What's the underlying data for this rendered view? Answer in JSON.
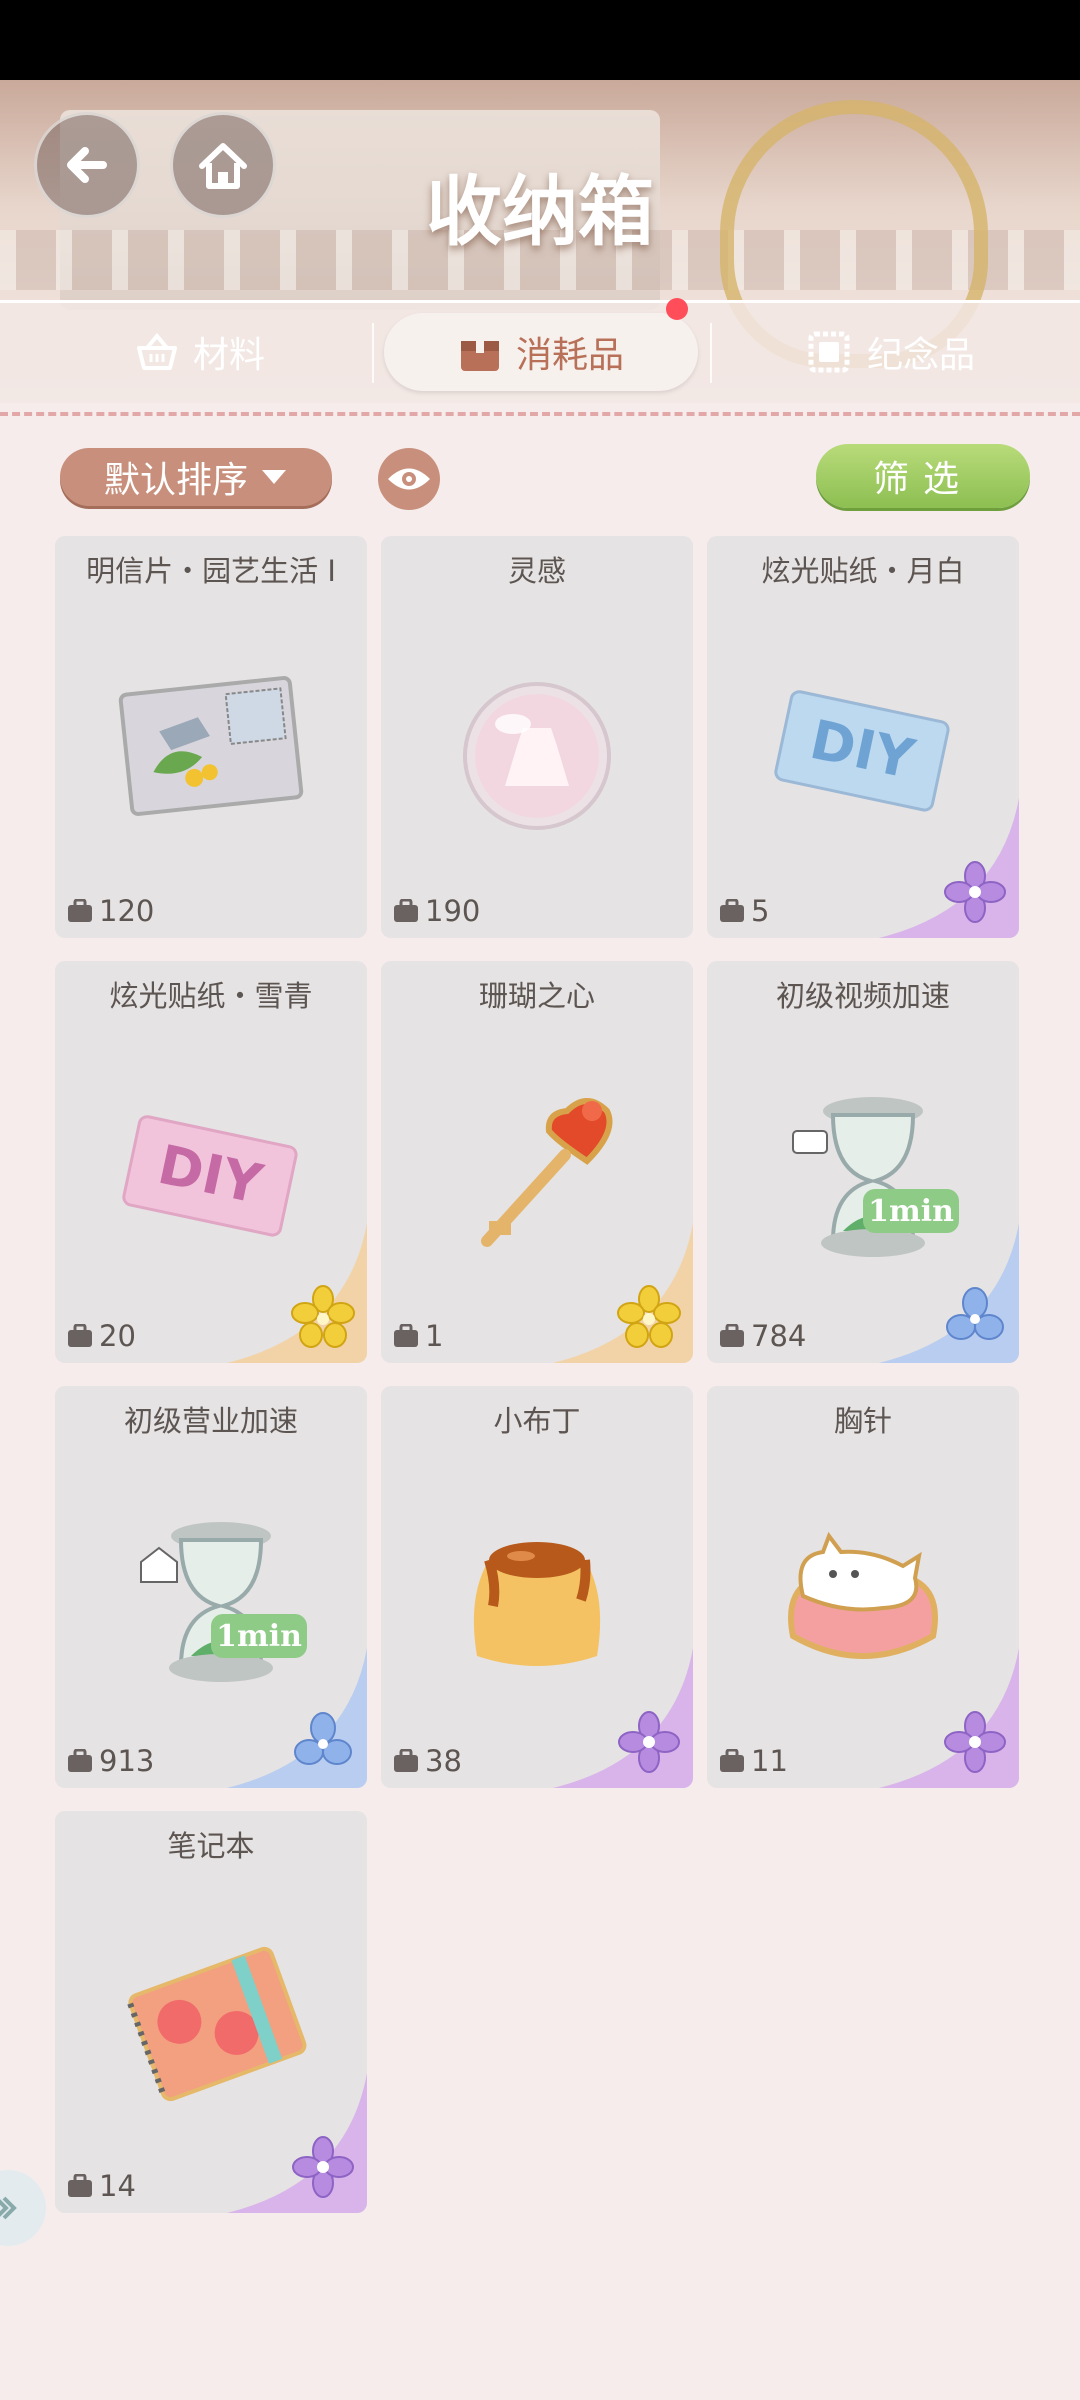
{
  "header": {
    "title": "收纳箱"
  },
  "tabs": [
    {
      "label": "材料",
      "icon": "basket-icon",
      "active": false
    },
    {
      "label": "消耗品",
      "icon": "box-icon",
      "active": true
    },
    {
      "label": "纪念品",
      "icon": "stamp-icon",
      "active": false
    }
  ],
  "toolbar": {
    "sort_label": "默认排序",
    "filter_label": "筛选"
  },
  "items": [
    {
      "name": "明信片・园艺生活 I",
      "count": "120",
      "rarity": "none",
      "icon": "postcard-icon"
    },
    {
      "name": "灵感",
      "count": "190",
      "rarity": "none",
      "icon": "inspiration-orb-icon"
    },
    {
      "name": "炫光贴纸・月白",
      "count": "5",
      "rarity": "purple",
      "icon": "diy-sticker-blue-icon"
    },
    {
      "name": "炫光贴纸・雪青",
      "count": "20",
      "rarity": "gold",
      "icon": "diy-sticker-pink-icon"
    },
    {
      "name": "珊瑚之心",
      "count": "1",
      "rarity": "gold",
      "icon": "heart-key-icon"
    },
    {
      "name": "初级视频加速",
      "count": "784",
      "rarity": "blue",
      "icon": "hourglass-video-icon",
      "badge": "1min"
    },
    {
      "name": "初级营业加速",
      "count": "913",
      "rarity": "blue",
      "icon": "hourglass-shop-icon",
      "badge": "1min"
    },
    {
      "name": "小布丁",
      "count": "38",
      "rarity": "purple",
      "icon": "pudding-icon"
    },
    {
      "name": "胸针",
      "count": "11",
      "rarity": "purple",
      "icon": "cat-brooch-icon"
    },
    {
      "name": "笔记本",
      "count": "14",
      "rarity": "purple",
      "icon": "notebook-icon"
    }
  ],
  "colors": {
    "accent": "#c8907c",
    "filter": "#9cc95f",
    "tab_active_text": "#b87058",
    "notify_dot": "#ff4d5a"
  }
}
